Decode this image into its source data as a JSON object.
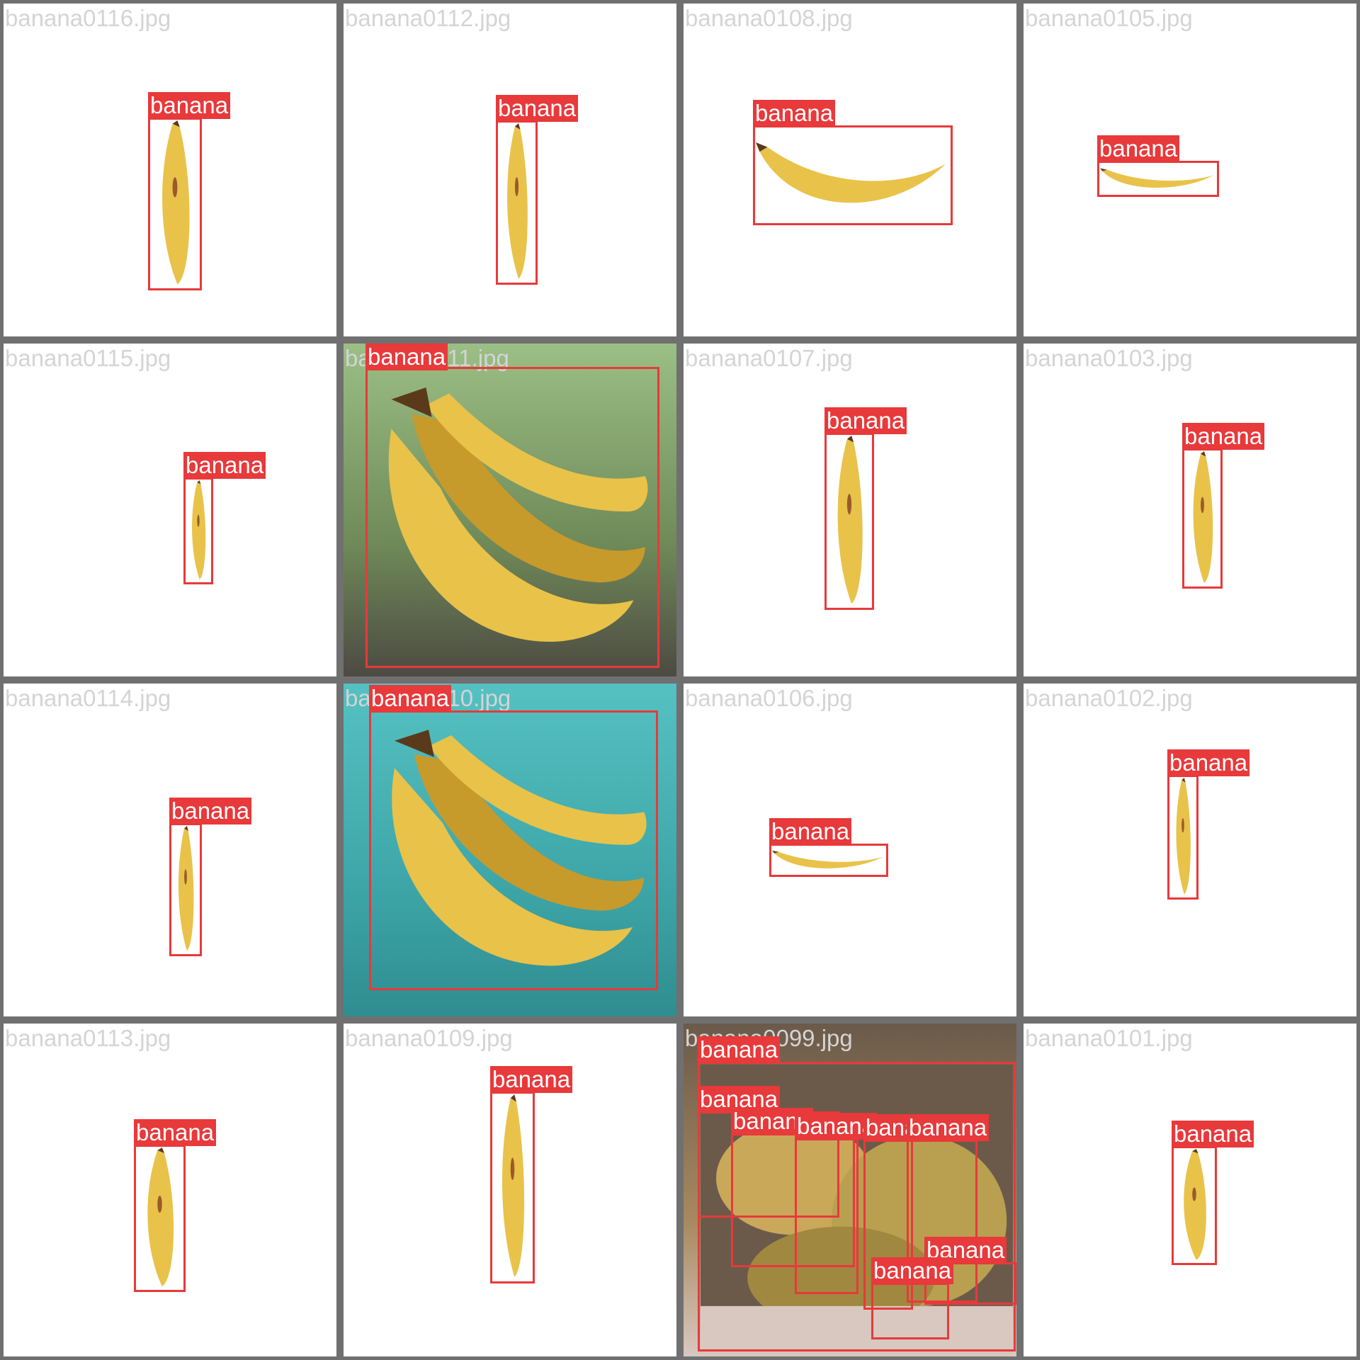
{
  "title": "",
  "colors": {
    "grid_border": "#707070",
    "cell_background": "#ffffff",
    "box": "#e8393b",
    "label_text": "#ffffff",
    "filename_text": "#d4d4d4"
  },
  "tiles": [
    {
      "file": "banana0116.jpg",
      "scene": "white",
      "fruit": "vertical-ripe",
      "boxes": [
        {
          "label": "banana"
        }
      ]
    },
    {
      "file": "banana0112.jpg",
      "scene": "white",
      "fruit": "vertical-ripe",
      "boxes": [
        {
          "label": "banana"
        }
      ]
    },
    {
      "file": "banana0108.jpg",
      "scene": "white",
      "fruit": "horizontal-yellow",
      "boxes": [
        {
          "label": "banana"
        }
      ]
    },
    {
      "file": "banana0105.jpg",
      "scene": "white",
      "fruit": "horizontal-small",
      "boxes": [
        {
          "label": "banana"
        }
      ]
    },
    {
      "file": "banana0115.jpg",
      "scene": "white",
      "fruit": "vertical-small",
      "boxes": [
        {
          "label": "banana"
        }
      ]
    },
    {
      "file": "banana0111.jpg",
      "scene": "photo-green",
      "fruit": "bunch",
      "boxes": [
        {
          "label": "banana"
        }
      ]
    },
    {
      "file": "banana0107.jpg",
      "scene": "white",
      "fruit": "vertical-ripe",
      "boxes": [
        {
          "label": "banana"
        }
      ]
    },
    {
      "file": "banana0103.jpg",
      "scene": "white",
      "fruit": "vertical-small",
      "boxes": [
        {
          "label": "banana"
        }
      ]
    },
    {
      "file": "banana0114.jpg",
      "scene": "white",
      "fruit": "vertical-small",
      "boxes": [
        {
          "label": "banana"
        }
      ]
    },
    {
      "file": "banana0110.jpg",
      "scene": "photo-teal",
      "fruit": "bunch",
      "boxes": [
        {
          "label": "banana"
        }
      ]
    },
    {
      "file": "banana0106.jpg",
      "scene": "white",
      "fruit": "horizontal-small",
      "boxes": [
        {
          "label": "banana"
        }
      ]
    },
    {
      "file": "banana0102.jpg",
      "scene": "white",
      "fruit": "vertical-small",
      "boxes": [
        {
          "label": "banana"
        }
      ]
    },
    {
      "file": "banana0113.jpg",
      "scene": "white",
      "fruit": "vertical-ripe",
      "boxes": [
        {
          "label": "banana"
        }
      ]
    },
    {
      "file": "banana0109.jpg",
      "scene": "white",
      "fruit": "vertical-ripe",
      "boxes": [
        {
          "label": "banana"
        }
      ]
    },
    {
      "file": "banana0099.jpg",
      "scene": "photo-market",
      "fruit": "market",
      "boxes": [
        {
          "label": "banana"
        },
        {
          "label": "banana"
        },
        {
          "label": "banana"
        },
        {
          "label": "banana"
        },
        {
          "label": "banana"
        },
        {
          "label": "banana"
        },
        {
          "label": "banana"
        },
        {
          "label": "banana"
        }
      ]
    },
    {
      "file": "banana0101.jpg",
      "scene": "white",
      "fruit": "vertical-ripe",
      "boxes": [
        {
          "label": "banana"
        }
      ]
    }
  ]
}
